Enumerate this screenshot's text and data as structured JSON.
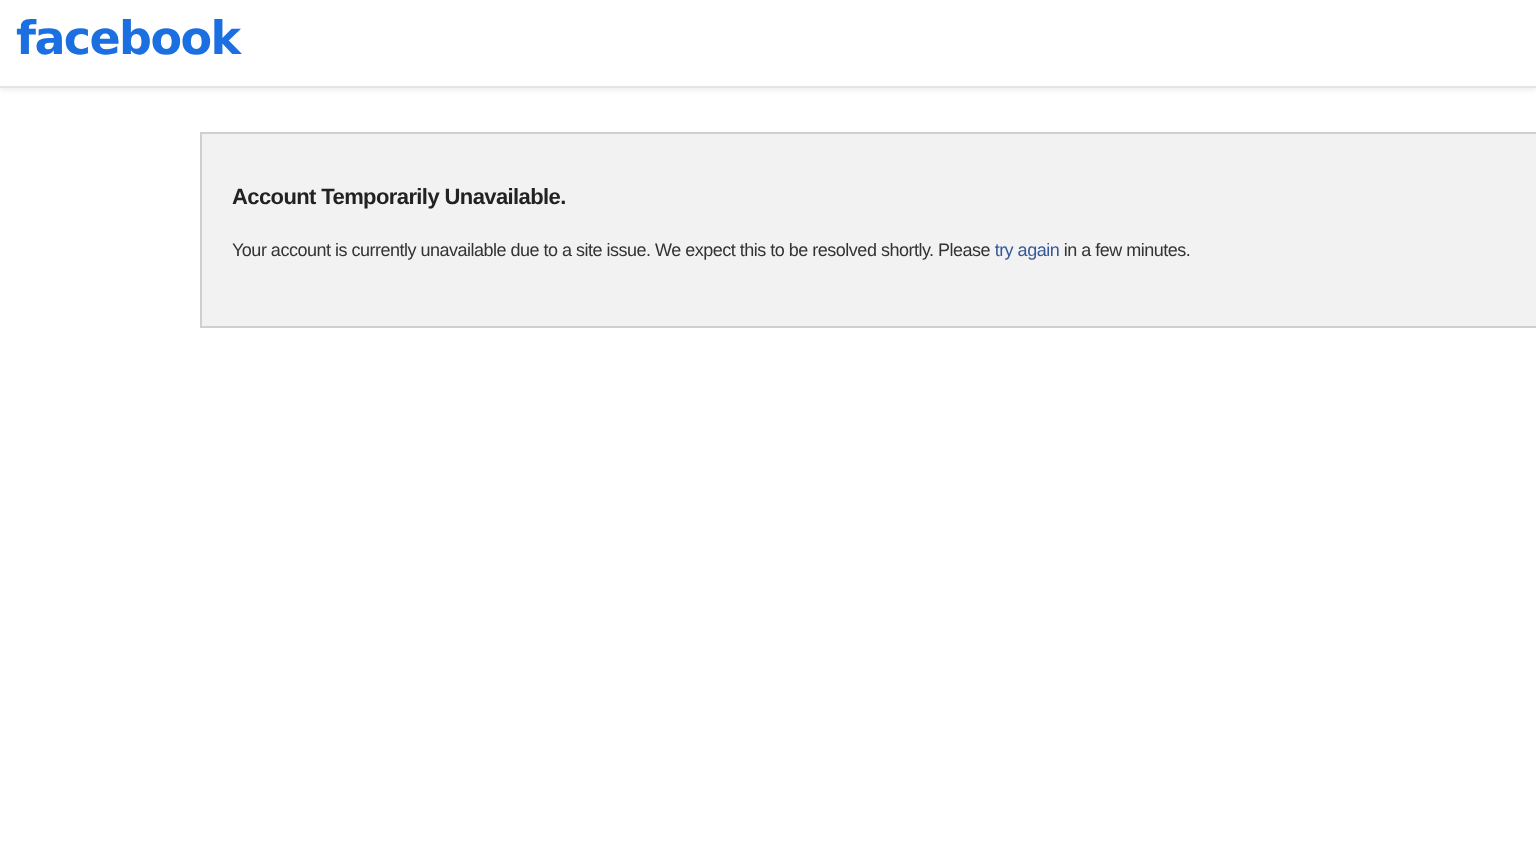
{
  "header": {
    "logo": "facebook"
  },
  "notice": {
    "title": "Account Temporarily Unavailable.",
    "message_before": "Your account is currently unavailable due to a site issue. We expect this to be resolved shortly. Please ",
    "link": "try again",
    "message_after": " in a few minutes."
  }
}
